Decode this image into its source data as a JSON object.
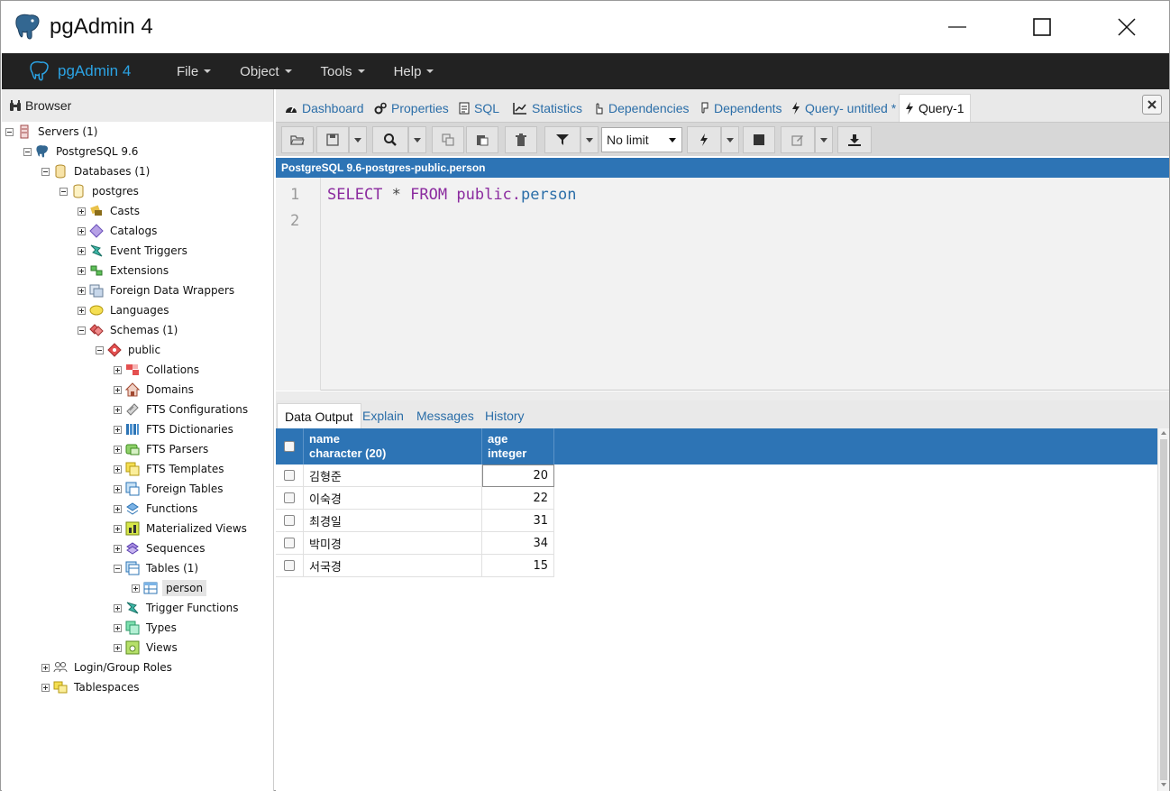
{
  "window": {
    "title": "pgAdmin 4"
  },
  "menubar": {
    "brand": "pgAdmin 4",
    "items": [
      "File",
      "Object",
      "Tools",
      "Help"
    ]
  },
  "browser": {
    "title": "Browser",
    "tree": [
      "Servers (1)",
      "PostgreSQL 9.6",
      "Databases (1)",
      "postgres",
      "Casts",
      "Catalogs",
      "Event Triggers",
      "Extensions",
      "Foreign Data Wrappers",
      "Languages",
      "Schemas (1)",
      "public",
      "Collations",
      "Domains",
      "FTS Configurations",
      "FTS Dictionaries",
      "FTS Parsers",
      "FTS Templates",
      "Foreign Tables",
      "Functions",
      "Materialized Views",
      "Sequences",
      "Tables (1)",
      "person",
      "Trigger Functions",
      "Types",
      "Views",
      "Login/Group Roles",
      "Tablespaces"
    ]
  },
  "tabs": [
    "Dashboard",
    "Properties",
    "SQL",
    "Statistics",
    "Dependencies",
    "Dependents",
    "Query- untitled *",
    "Query-1"
  ],
  "toolbar": {
    "limit": "No limit"
  },
  "connection": "PostgreSQL 9.6-postgres-public.person",
  "editor": {
    "line_numbers": [
      "1",
      "2"
    ],
    "sql": {
      "select": "SELECT",
      "star": "*",
      "from": "FROM",
      "schema": "public.",
      "table": "person"
    }
  },
  "output_tabs": [
    "Data Output",
    "Explain",
    "Messages",
    "History"
  ],
  "grid": {
    "columns": [
      {
        "name": "name",
        "type": "character (20)"
      },
      {
        "name": "age",
        "type": "integer"
      }
    ],
    "rows": [
      {
        "name": "김형준",
        "age": "20"
      },
      {
        "name": "이숙경",
        "age": "22"
      },
      {
        "name": "최경일",
        "age": "31"
      },
      {
        "name": "박미경",
        "age": "34"
      },
      {
        "name": "서국경",
        "age": "15"
      }
    ]
  },
  "colors": {
    "menubar": "#222222",
    "accent": "#2d74b5",
    "brand": "#2ba3e4"
  }
}
